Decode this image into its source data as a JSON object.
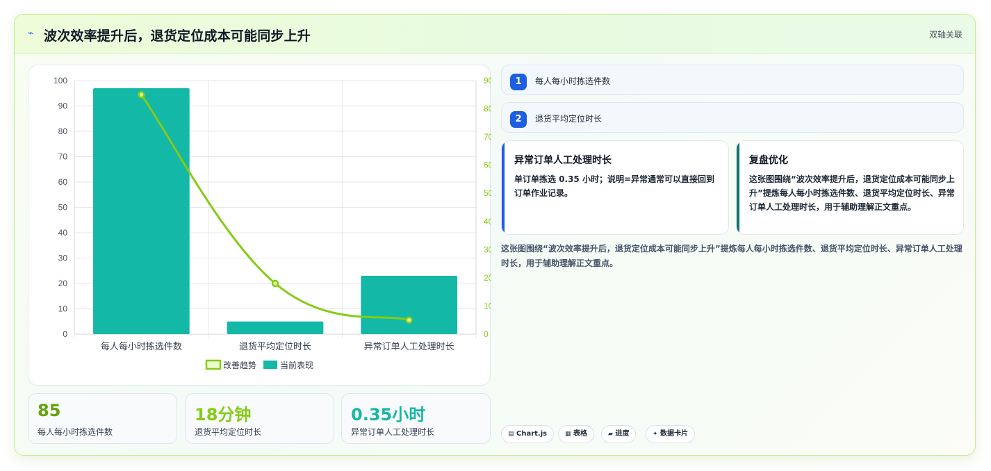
{
  "header": {
    "icon": "bolt-icon",
    "title": "波次效率提升后，退货定位成本可能同步上升",
    "tag": "双轴关联"
  },
  "chart_data": {
    "type": "bar",
    "categories": [
      "每人每小时拣选件数",
      "退货平均定位时长",
      "异常订单人工处理时长"
    ],
    "series": [
      {
        "name": "当前表现",
        "type": "bar",
        "axis": "left",
        "color": "#14b8a6",
        "values": [
          97,
          5,
          23
        ]
      },
      {
        "name": "改善趋势",
        "type": "line",
        "axis": "right",
        "color": "#84cc16",
        "values": [
          85,
          18,
          5
        ]
      }
    ],
    "y_left": {
      "min": 0,
      "max": 100,
      "ticks": [
        0,
        10,
        20,
        30,
        40,
        50,
        60,
        70,
        80,
        90,
        100
      ]
    },
    "y_right": {
      "min": 0,
      "max": 90,
      "ticks": [
        0,
        10,
        20,
        30,
        40,
        50,
        60,
        70,
        80,
        90
      ]
    },
    "legend": [
      "改善趋势",
      "当前表现"
    ],
    "legend_position": "bottom",
    "grid": true
  },
  "stats": [
    {
      "value": "85",
      "label": "每人每小时拣选件数",
      "color": "#65a30d"
    },
    {
      "value": "18分钟",
      "label": "退货平均定位时长",
      "color": "#84cc16"
    },
    {
      "value": "0.35小时",
      "label": "异常订单人工处理时长",
      "color": "#14b8a6"
    }
  ],
  "steps": [
    {
      "num": "1",
      "text": "每人每小时拣选件数"
    },
    {
      "num": "2",
      "text": "退货平均定位时长"
    }
  ],
  "notes": [
    {
      "title": "异常订单人工处理时长",
      "body": "单订单拣选 0.35 小时；说明=异常通常可以直接回到订单作业记录。",
      "accent": "#1d5fe0"
    },
    {
      "title": "复盘优化",
      "body": "这张图围绕“波次效率提升后，退货定位成本可能同步上升”提炼每人每小时拣选件数、退货平均定位时长、异常订单人工处理时长，用于辅助理解正文重点。",
      "accent": "#0f766e"
    }
  ],
  "description": "这张图围绕“波次效率提升后，退货定位成本可能同步上升”提炼每人每小时拣选件数、退货平均定位时长、异常订单人工处理时长，用于辅助理解正文重点。",
  "footer_pills": [
    {
      "icon": "chart-icon",
      "glyph": "▤",
      "label": "Chart.js"
    },
    {
      "icon": "table-icon",
      "glyph": "▦",
      "label": "表格"
    },
    {
      "icon": "progress-icon",
      "glyph": "▰",
      "label": "进度"
    },
    {
      "icon": "sparkle-icon",
      "glyph": "✦",
      "label": "数据卡片"
    }
  ]
}
